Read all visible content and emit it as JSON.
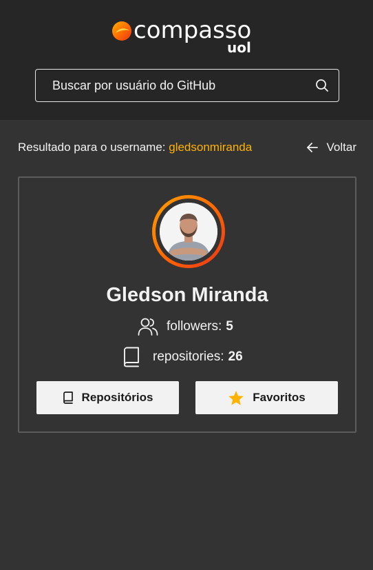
{
  "brand": {
    "name": "compasso",
    "sub": "uol",
    "accent": "#ffb300",
    "gradient": [
      "#ffa000",
      "#ff6a00",
      "#e8341c"
    ]
  },
  "search": {
    "placeholder": "Buscar por usuário do GitHub",
    "value": "",
    "icon": "search-icon"
  },
  "result": {
    "prefix": "Resultado para o username: ",
    "username": "gledsonmiranda"
  },
  "back": {
    "label": "Voltar",
    "icon": "arrow-left-icon"
  },
  "profile": {
    "name": "Gledson Miranda",
    "followers_label": "followers:",
    "followers_count": "5",
    "repositories_label": "repositories:",
    "repositories_count": "26"
  },
  "actions": {
    "repos_label": "Repositórios",
    "repos_icon": "book-icon",
    "favs_label": "Favoritos",
    "favs_icon": "star-icon"
  },
  "colors": {
    "background": "#333333",
    "header": "#262626",
    "card_border": "#5c5c5c",
    "button_bg": "#f2f2f2",
    "star": "#ffb300"
  }
}
